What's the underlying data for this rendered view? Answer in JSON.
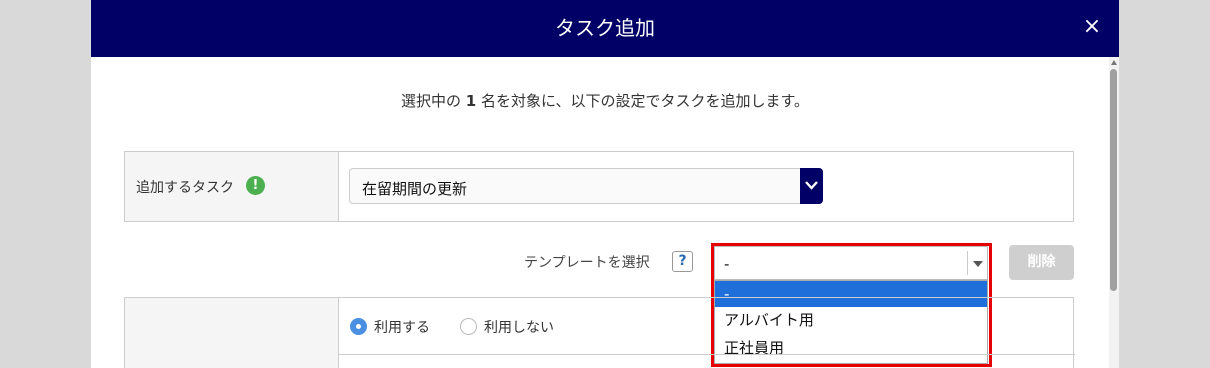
{
  "modal": {
    "title": "タスク追加",
    "close_glyph": "×"
  },
  "description": {
    "prefix": "選択中の",
    "count": "1",
    "suffix": "名を対象に、以下の設定でタスクを追加します。"
  },
  "task": {
    "label": "追加するタスク",
    "info_glyph": "!",
    "selected": "在留期間の更新"
  },
  "template": {
    "label": "テンプレートを選択",
    "help_glyph": "?",
    "selected": "-",
    "options": [
      "-",
      "アルバイト用",
      "正社員用"
    ]
  },
  "delete_label": "削除",
  "usage": {
    "use_label": "利用する",
    "not_use_label": "利用しない"
  },
  "colors": {
    "header": "#000066",
    "highlight": "#e60000",
    "selected_option": "#1e6fd9"
  }
}
